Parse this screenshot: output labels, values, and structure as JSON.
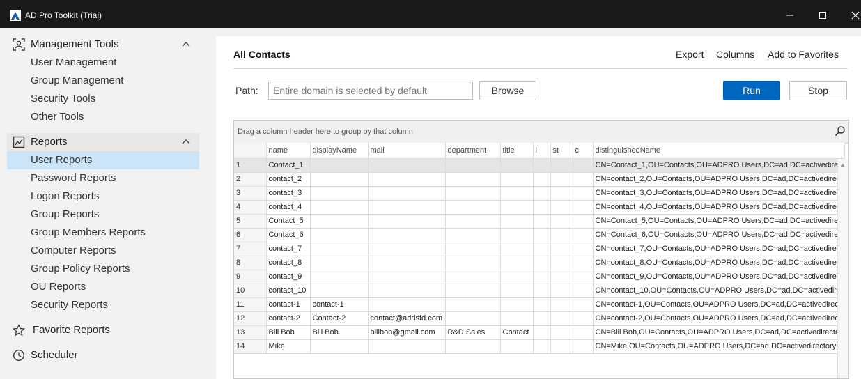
{
  "window": {
    "title": "AD Pro Toolkit (Trial)"
  },
  "sidebar": {
    "sections": [
      {
        "label": "Management Tools",
        "icon": "management-tools-icon",
        "items": [
          "User Management",
          "Group Management",
          "Security Tools",
          "Other Tools"
        ]
      },
      {
        "label": "Reports",
        "icon": "reports-chart-icon",
        "items": [
          "User Reports",
          "Password Reports",
          "Logon Reports",
          "Group Reports",
          "Group Members Reports",
          "Computer Reports",
          "Group Policy Reports",
          "OU Reports",
          "Security Reports"
        ],
        "selected": "User Reports"
      },
      {
        "label": "Favorite Reports",
        "icon": "star-icon"
      },
      {
        "label": "Scheduler",
        "icon": "clock-icon"
      }
    ]
  },
  "main": {
    "title": "All Contacts",
    "actions": {
      "export": "Export",
      "columns": "Columns",
      "favorites": "Add to Favorites"
    },
    "path_label": "Path:",
    "path_placeholder": "Entire domain is selected by default",
    "browse_label": "Browse",
    "run_label": "Run",
    "stop_label": "Stop"
  },
  "grid": {
    "group_hint": "Drag a column header here to group by that column",
    "columns": [
      "name",
      "displayName",
      "mail",
      "department",
      "title",
      "l",
      "st",
      "c",
      "distinguishedName"
    ],
    "rows": [
      [
        "1",
        "Contact_1",
        "",
        "",
        "",
        "",
        "",
        "",
        "",
        "CN=Contact_1,OU=Contacts,OU=ADPRO Users,DC=ad,DC=activedirec"
      ],
      [
        "2",
        "contact_2",
        "",
        "",
        "",
        "",
        "",
        "",
        "",
        "CN=contact_2,OU=Contacts,OU=ADPRO Users,DC=ad,DC=activedirec"
      ],
      [
        "3",
        "contact_3",
        "",
        "",
        "",
        "",
        "",
        "",
        "",
        "CN=contact_3,OU=Contacts,OU=ADPRO Users,DC=ad,DC=activedirec"
      ],
      [
        "4",
        "contact_4",
        "",
        "",
        "",
        "",
        "",
        "",
        "",
        "CN=contact_4,OU=Contacts,OU=ADPRO Users,DC=ad,DC=activedirec"
      ],
      [
        "5",
        "Contact_5",
        "",
        "",
        "",
        "",
        "",
        "",
        "",
        "CN=Contact_5,OU=Contacts,OU=ADPRO Users,DC=ad,DC=activedirec"
      ],
      [
        "6",
        "Contact_6",
        "",
        "",
        "",
        "",
        "",
        "",
        "",
        "CN=Contact_6,OU=Contacts,OU=ADPRO Users,DC=ad,DC=activedirec"
      ],
      [
        "7",
        "contact_7",
        "",
        "",
        "",
        "",
        "",
        "",
        "",
        "CN=contact_7,OU=Contacts,OU=ADPRO Users,DC=ad,DC=activedirec"
      ],
      [
        "8",
        "contact_8",
        "",
        "",
        "",
        "",
        "",
        "",
        "",
        "CN=contact_8,OU=Contacts,OU=ADPRO Users,DC=ad,DC=activedirec"
      ],
      [
        "9",
        "contact_9",
        "",
        "",
        "",
        "",
        "",
        "",
        "",
        "CN=contact_9,OU=Contacts,OU=ADPRO Users,DC=ad,DC=activedirec"
      ],
      [
        "10",
        "contact_10",
        "",
        "",
        "",
        "",
        "",
        "",
        "",
        "CN=contact_10,OU=Contacts,OU=ADPRO Users,DC=ad,DC=activedire"
      ],
      [
        "11",
        "contact-1",
        "contact-1",
        "",
        "",
        "",
        "",
        "",
        "",
        "CN=contact-1,OU=Contacts,OU=ADPRO Users,DC=ad,DC=activedirect"
      ],
      [
        "12",
        "contact-2",
        "Contact-2",
        "contact@addsfd.com",
        "",
        "",
        "",
        "",
        "",
        "CN=contact-2,OU=Contacts,OU=ADPRO Users,DC=ad,DC=activedirect"
      ],
      [
        "13",
        "Bill Bob",
        "Bill Bob",
        "billbob@gmail.com",
        "R&D Sales",
        "Contact",
        "",
        "",
        "",
        "CN=Bill Bob,OU=Contacts,OU=ADPRO Users,DC=ad,DC=activedirector"
      ],
      [
        "14",
        "Mike",
        "",
        "",
        "",
        "",
        "",
        "",
        "",
        "CN=Mike,OU=Contacts,OU=ADPRO Users,DC=ad,DC=activedirectorypi"
      ]
    ],
    "selected_row": "1"
  }
}
